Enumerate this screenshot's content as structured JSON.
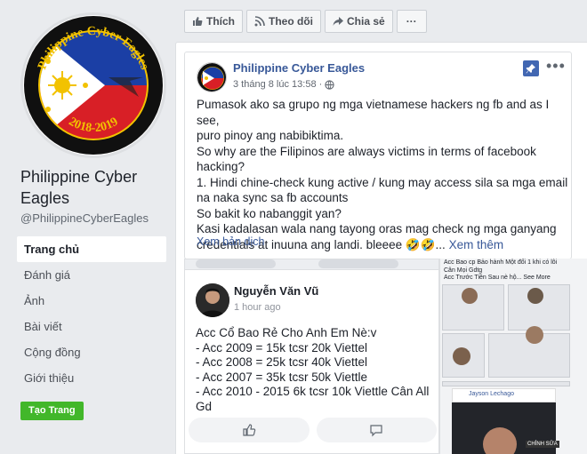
{
  "page": {
    "name": "Philippine Cyber Eagles",
    "handle": "@PhilippineCyberEagles",
    "logo_text": "Philippine Cyber Eagles",
    "logo_years": "2018-2019"
  },
  "nav": [
    {
      "label": "Trang chủ",
      "active": true
    },
    {
      "label": "Đánh giá"
    },
    {
      "label": "Ảnh"
    },
    {
      "label": "Bài viết"
    },
    {
      "label": "Cộng đồng"
    },
    {
      "label": "Giới thiệu"
    }
  ],
  "create_page_button": "Tạo Trang",
  "action_bar": {
    "like": "Thích",
    "follow": "Theo dõi",
    "share": "Chia sẻ",
    "more": "···"
  },
  "post": {
    "author": "Philippine Cyber Eagles",
    "timestamp": "3 tháng 8 lúc 13:58",
    "separator": "·",
    "lines": [
      "Pumasok ako sa grupo ng mga vietnamese hackers ng fb and as I see,",
      "puro pinoy ang nabibiktima.",
      "So why are the Filipinos are always victims in terms of facebook",
      "hacking?",
      "1. Hindi chine-check kung active / kung may access sila sa mga email",
      "na naka sync sa fb accounts",
      "So bakit ko nabanggit yan?",
      "Kasi kadalasan wala nang tayong oras mag check ng mga ganyang"
    ],
    "last_line": "credentials at inuuna ang landi. bleeee 🤣🤣...",
    "see_more": "Xem thêm",
    "translate": "Xem bản dịch"
  },
  "shared_post": {
    "author": "Nguyễn Văn Vũ",
    "time": "1 hour ago",
    "lines": [
      "Acc Cổ Bao Rẻ Cho Anh Em Nè:v",
      "- Acc 2009 = 15k tcsr 20k Viettel",
      "- Acc 2008 = 25k tcsr 40k Viettel",
      "- Acc 2007 = 35k tcsr 50k Viettle",
      "- Acc 2010 - 2015 6k tcsr 10k Viettle Cân All",
      "Gd"
    ]
  },
  "thumbnail": {
    "lines": [
      "Acc Bao cp Bảo hành Một đổi 1 khi có lỗi",
      "Cân Mọi Gdtg",
      "Acc Trước Tiền Sau nè hộ... See More"
    ],
    "video_author": "Jayson Lechago",
    "badge": "CHỈNH SỬA"
  },
  "colors": {
    "accent": "#4267b2",
    "link": "#385898",
    "create_button": "#42b72a",
    "background": "#e9ebee"
  }
}
